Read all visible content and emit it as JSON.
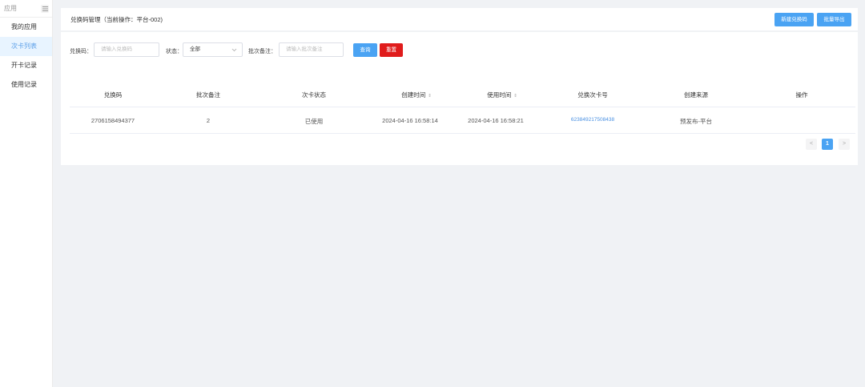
{
  "sidebar": {
    "title": "应用",
    "items": [
      {
        "label": "我的应用",
        "active": false
      },
      {
        "label": "次卡列表",
        "active": true
      },
      {
        "label": "开卡记录",
        "active": false
      },
      {
        "label": "使用记录",
        "active": false
      }
    ]
  },
  "header": {
    "title": "兑换码管理（当前操作：平台-002)",
    "new_button": "新建兑换码",
    "export_button": "批量导出"
  },
  "filters": {
    "code_label": "兑换码：",
    "code_placeholder": "请输入兑换码",
    "status_label": "状态：",
    "status_value": "全部",
    "batch_label": "批次备注：",
    "batch_placeholder": "请输入批次备注",
    "search_button": "查询",
    "reset_button": "重置"
  },
  "table": {
    "columns": [
      "兑换码",
      "批次备注",
      "次卡状态",
      "创建时间",
      "使用时间",
      "兑换次卡号",
      "创建来源",
      "操作"
    ],
    "rows": [
      {
        "code": "2706158494377",
        "batch": "2",
        "status": "已使用",
        "created": "2024-04-16 16:58:14",
        "used": "2024-04-16 16:58:21",
        "card_no": "623849217508438",
        "source": "预发布-平台",
        "action": ""
      }
    ]
  },
  "pagination": {
    "prev": "<",
    "current": "1",
    "next": ">"
  },
  "colors": {
    "primary": "#4aa3f3",
    "danger": "#e01c1c",
    "active_bg": "#e8f4ff",
    "link": "#4a90e2"
  }
}
